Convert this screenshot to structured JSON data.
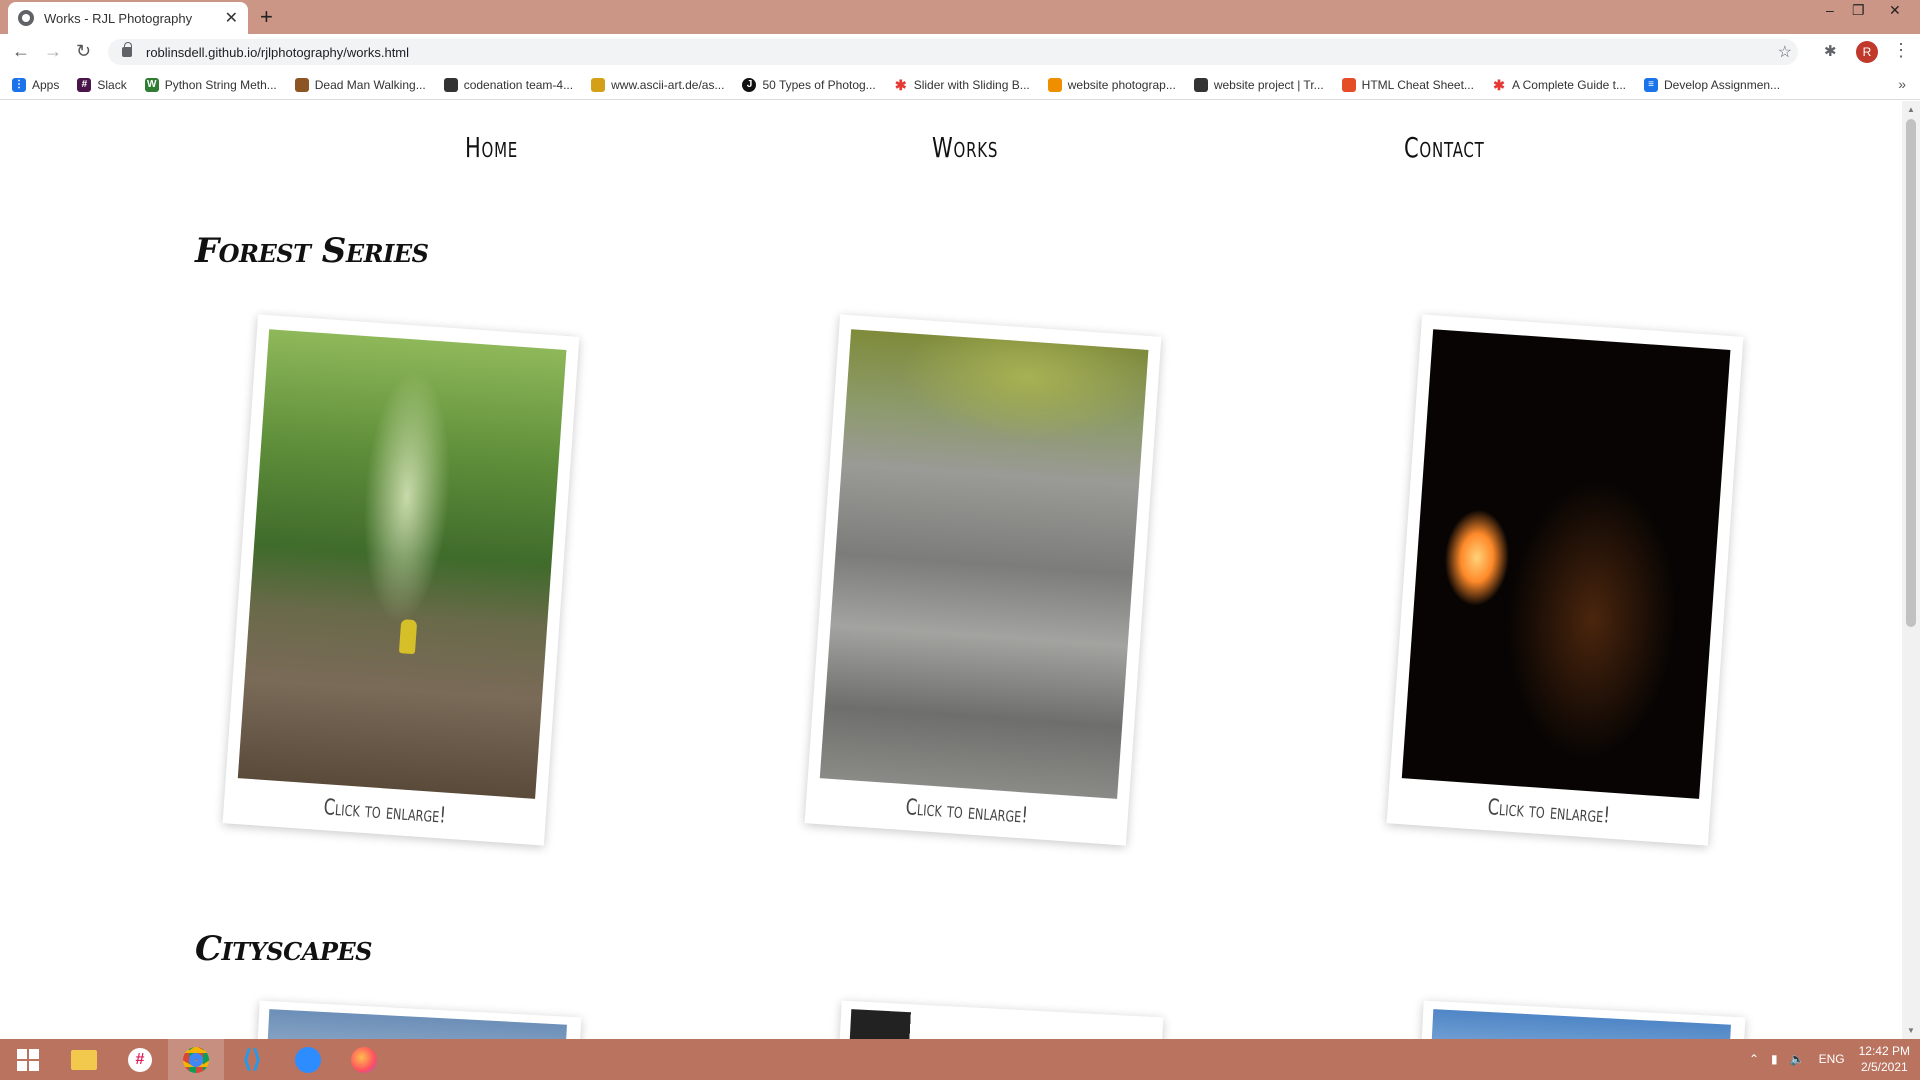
{
  "browser": {
    "tab_title": "Works - RJL Photography",
    "new_tab": "+",
    "url": "roblinsdell.github.io/rjlphotography/works.html",
    "profile_initial": "R",
    "bookmarks": [
      {
        "label": "Apps",
        "color": "#1a73e8"
      },
      {
        "label": "Slack",
        "color": "#4a154b"
      },
      {
        "label": "Python String Meth...",
        "color": "#2e7d32"
      },
      {
        "label": "Dead Man Walking...",
        "color": "#8d5524"
      },
      {
        "label": "codenation team-4...",
        "color": "#333333"
      },
      {
        "label": "www.ascii-art.de/as...",
        "color": "#d4a017"
      },
      {
        "label": "50 Types of Photog...",
        "color": "#111111"
      },
      {
        "label": "Slider with Sliding B...",
        "color": "#e53935"
      },
      {
        "label": "website photograp...",
        "color": "#ef8f00"
      },
      {
        "label": "website project | Tr...",
        "color": "#333333"
      },
      {
        "label": "HTML Cheat Sheet...",
        "color": "#e44d26"
      },
      {
        "label": "A Complete Guide t...",
        "color": "#e53935"
      },
      {
        "label": "Develop Assignmen...",
        "color": "#1a73e8"
      }
    ]
  },
  "site": {
    "nav": [
      "Home",
      "Works",
      "Contact"
    ],
    "sections": [
      {
        "title": "Forest Series",
        "caption": "Click to enlarge!"
      },
      {
        "title": "Cityscapes"
      }
    ]
  },
  "taskbar": {
    "lang": "ENG",
    "time": "12:42 PM",
    "date": "2/5/2021"
  }
}
